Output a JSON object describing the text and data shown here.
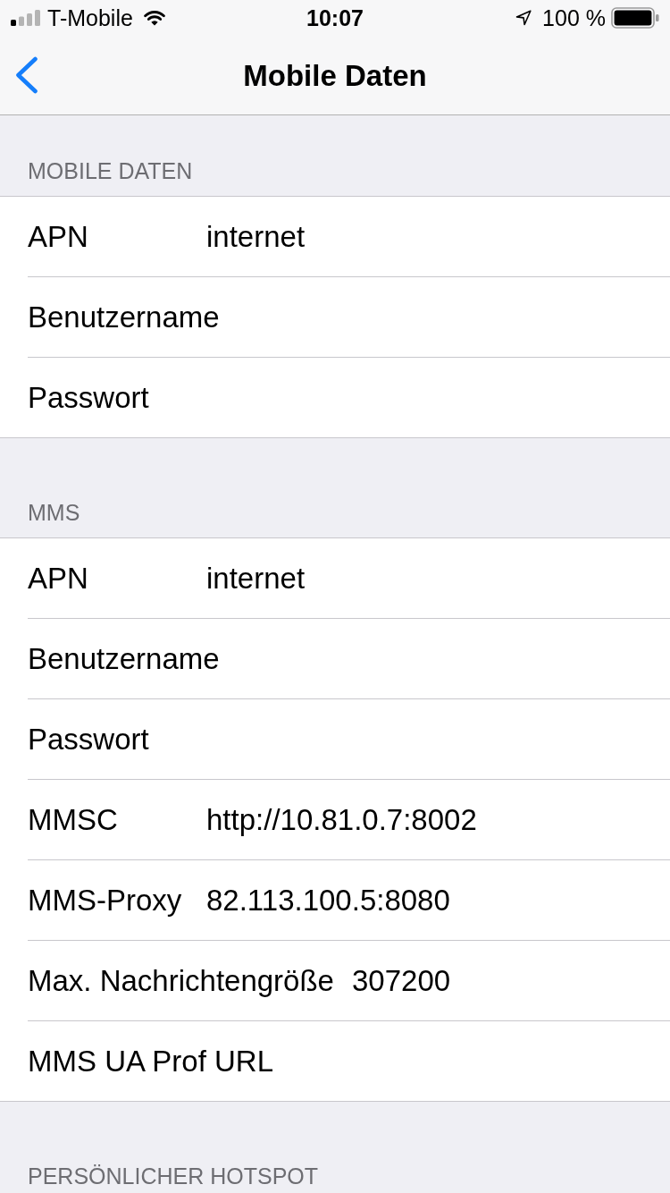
{
  "status_bar": {
    "carrier": "T-Mobile",
    "time": "10:07",
    "battery": "100 %"
  },
  "nav_bar": {
    "title": "Mobile Daten"
  },
  "sections": [
    {
      "header": "MOBILE DATEN",
      "rows": [
        {
          "label": "APN",
          "value": "internet"
        },
        {
          "label": "Benutzername"
        },
        {
          "label": "Passwort"
        }
      ]
    },
    {
      "header": "MMS",
      "rows": [
        {
          "label": "APN",
          "value": "internet"
        },
        {
          "label": "Benutzername"
        },
        {
          "label": "Passwort"
        },
        {
          "label": "MMSC",
          "value": "http://10.81.0.7:8002"
        },
        {
          "label": "MMS-Proxy",
          "value": "82.113.100.5:8080"
        },
        {
          "label": "Max. Nachrichtengröße",
          "value": "307200"
        },
        {
          "label": "MMS UA Prof URL"
        }
      ]
    },
    {
      "header": "PERSÖNLICHER HOTSPOT"
    }
  ]
}
